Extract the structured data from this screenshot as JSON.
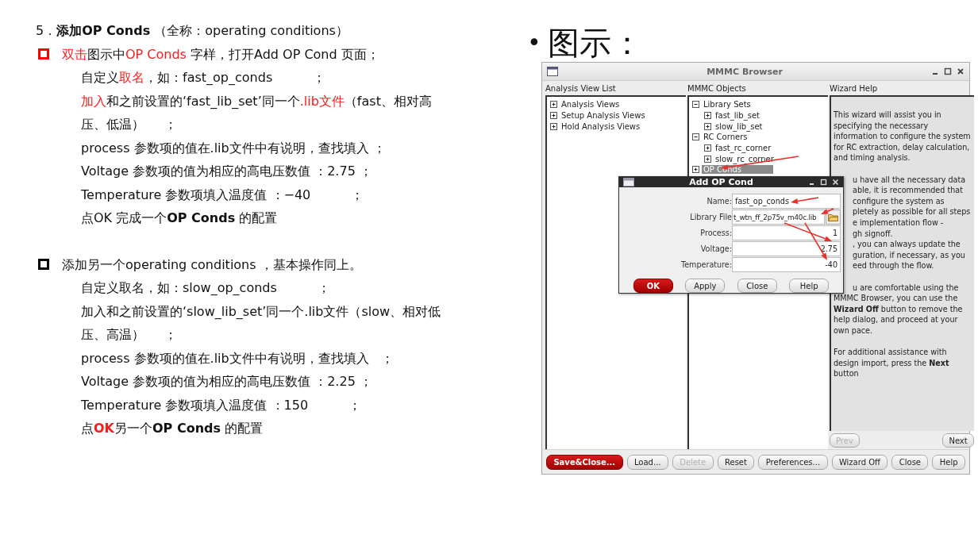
{
  "slide": {
    "heading": "5．**添加OP Conds** （全称：operating conditions）",
    "sections": [
      {
        "color": "#ff0000",
        "lead": [
          {
            "text": "双击",
            "red": true
          },
          {
            "text": "图示中",
            "red": false
          },
          {
            "text": "OP Conds",
            "red": true
          },
          {
            "text": " 字样，打开Add OP Cond 页面；",
            "red": false
          }
        ],
        "lines": [
          [
            {
              "text": "自定义",
              "red": false
            },
            {
              "text": "取名",
              "red": true
            },
            {
              "text": "，如：fast_op_conds          ；",
              "red": false
            }
          ],
          [
            {
              "text": "加入",
              "red": true
            },
            {
              "text": "和之前设置的‘fast_lib_set’同一个",
              "red": false
            },
            {
              "text": ".lib文件",
              "red": true
            },
            {
              "text": "（fast、相对高压、低温）     ；",
              "red": false
            }
          ],
          [
            {
              "text": "process 参数项的值在.lib文件中有说明，查找填入 ；",
              "red": false
            }
          ],
          [
            {
              "text": "Voltage 参数项的值为相应的高电压数值 ：2.75 ；",
              "red": false
            }
          ],
          [
            {
              "text": "Temperature 参数项填入温度值 ：−40          ；",
              "red": false
            }
          ],
          [
            {
              "text": "点OK 完成一个**OP Conds** 的配置",
              "red": false
            }
          ]
        ]
      },
      {
        "color": "#000000",
        "lead": [
          {
            "text": "添加另一个operating conditions ，基本操作同上。",
            "red": false
          }
        ],
        "lines": [
          [
            {
              "text": "自定义取名，如：slow_op_conds          ；",
              "red": false
            }
          ],
          [
            {
              "text": "加入和之前设置的‘slow_lib_set’同一个.lib文件（slow、相对低压、高温）     ；",
              "red": false
            }
          ],
          [
            {
              "text": "process 参数项的值在.lib文件中有说明，查找填入   ；",
              "red": false
            }
          ],
          [
            {
              "text": "Voltage 参数项的值为相应的高电压数值 ：2.25 ；",
              "red": false
            }
          ],
          [
            {
              "text": "Temperature 参数项填入温度值 ：150          ；",
              "red": false
            }
          ],
          [
            {
              "text": "点",
              "red": false
            },
            {
              "text": "**OK**",
              "red": true
            },
            {
              "text": "另一个**OP Conds** 的配置",
              "red": false
            }
          ]
        ]
      }
    ]
  },
  "figure": {
    "bullet": "•",
    "label": "图示："
  },
  "window": {
    "title": "MMMC Browser",
    "panes": [
      {
        "kind": "tree",
        "heading": "Analysis View List",
        "items": [
          {
            "label": "Analysis Views",
            "expanded": false,
            "selected": false
          },
          {
            "label": "Setup Analysis Views",
            "expanded": false,
            "selected": false
          },
          {
            "label": "Hold Analysis Views",
            "expanded": false,
            "selected": false
          }
        ]
      },
      {
        "kind": "tree",
        "heading": "MMMC Objects",
        "items": [
          {
            "label": "Library Sets",
            "expanded": true,
            "selected": false,
            "children": [
              {
                "label": "fast_lib_set",
                "expanded": false,
                "selected": false
              },
              {
                "label": "slow_lib_set",
                "expanded": false,
                "selected": false
              }
            ]
          },
          {
            "label": "RC Corners",
            "expanded": true,
            "selected": false,
            "children": [
              {
                "label": "fast_rc_corner",
                "expanded": false,
                "selected": false
              },
              {
                "label": "slow_rc_corner",
                "expanded": false,
                "selected": false
              }
            ]
          },
          {
            "label": "OP Conds",
            "expanded": false,
            "selected": true
          }
        ]
      },
      {
        "kind": "help",
        "heading": "Wizard Help",
        "paragraphs": [
          {
            "lines": [
              {
                "text": "This wizard will assist you in",
                "clipped": false
              },
              {
                "text": "specifying the necessary",
                "clipped": false
              },
              {
                "text": "information to configure the system",
                "clipped": false
              },
              {
                "text": "for RC extraction, delay calculation,",
                "clipped": false
              },
              {
                "text": "and timing analysis.",
                "clipped": false
              }
            ]
          },
          {
            "lines": [
              {
                "text": "u have all the necessary data",
                "clipped": true
              },
              {
                "text": "able, it is recommended that",
                "clipped": true
              },
              {
                "text": "configure the system as",
                "clipped": true
              },
              {
                "text": "pletely as possible for all steps",
                "clipped": true
              },
              {
                "text": "e implementation flow -",
                "clipped": true
              },
              {
                "text": "gh signoff.",
                "clipped": true
              },
              {
                "text": ", you can always update the",
                "clipped": true
              },
              {
                "text": "guration, if necessary, as you",
                "clipped": true
              },
              {
                "text": "eed through the flow.",
                "clipped": true
              }
            ]
          },
          {
            "lines": [
              {
                "text": "u are comfortable using the",
                "clipped": true
              },
              {
                "text": "MMMC Browser, you can use the",
                "clipped": false
              },
              {
                "text": "**Wizard Off** button to remove the",
                "clipped": false
              },
              {
                "text": "help dialog, and proceed at your",
                "clipped": false
              },
              {
                "text": "own pace.",
                "clipped": false
              }
            ]
          },
          {
            "lines": [
              {
                "text": "For additional assistance with",
                "clipped": false
              },
              {
                "text": "design import, press the **Next**",
                "clipped": false
              },
              {
                "text": "button",
                "clipped": false
              }
            ]
          }
        ],
        "buttons": [
          {
            "label": "Prev",
            "disabled": true
          },
          {
            "label": "Next",
            "disabled": false
          }
        ]
      }
    ],
    "buttons": [
      {
        "label": "Save&Close...",
        "kind": "primary",
        "disabled": false
      },
      {
        "label": "Load...",
        "kind": "normal",
        "disabled": false
      },
      {
        "label": "Delete",
        "kind": "normal",
        "disabled": true
      },
      {
        "label": "Reset",
        "kind": "normal",
        "disabled": false
      },
      {
        "label": "Preferences...",
        "kind": "normal",
        "disabled": false
      },
      {
        "label": "Wizard Off",
        "kind": "normal",
        "disabled": false
      },
      {
        "label": "Close",
        "kind": "normal",
        "disabled": false
      },
      {
        "label": "Help",
        "kind": "normal",
        "disabled": false
      }
    ],
    "dialog": {
      "title": "Add OP Cond",
      "fields": [
        {
          "kind": "text",
          "label": "Name:",
          "value": "fast_op_conds"
        },
        {
          "kind": "file",
          "label": "Library File",
          "value": "t_wtn_ff_2p75v_m40c.lib"
        },
        {
          "kind": "number",
          "label": "Process:",
          "value": "1"
        },
        {
          "kind": "number",
          "label": "Voltage:",
          "value": "2.75"
        },
        {
          "kind": "number",
          "label": "Temperature:",
          "value": "-40"
        }
      ],
      "buttons": [
        {
          "label": "OK",
          "kind": "primary"
        },
        {
          "label": "Apply",
          "kind": "normal"
        },
        {
          "label": "Close",
          "kind": "normal"
        },
        {
          "label": "Help",
          "kind": "normal"
        }
      ]
    }
  }
}
